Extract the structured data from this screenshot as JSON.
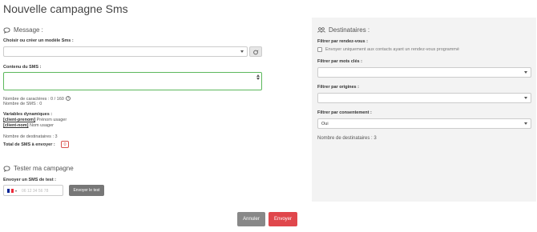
{
  "page": {
    "title": "Nouvelle campagne Sms"
  },
  "message": {
    "heading": "Message :",
    "model_label": "Choisir ou créer un modèle Sms :",
    "model_value": "",
    "content_label": "Contenu du SMS :",
    "content_value": "",
    "char_count": "Nombre de caractères : 0 / 160",
    "sms_count": "Nombre de SMS : 0",
    "vars_label": "Variables dynamiques :",
    "vars": [
      {
        "tag": "[client-prenom]",
        "desc": "Prénom usager"
      },
      {
        "tag": "[client-nom]",
        "desc": "Nom usager"
      }
    ],
    "recipients_count": "Nombre de destinataires : 3",
    "total_label": "Total de SMS à envoyer :",
    "total_value": "0"
  },
  "test": {
    "heading": "Tester ma campagne",
    "send_label": "Envoyer un SMS de test :",
    "phone_placeholder": "06 12 34 56 78",
    "send_button": "Envoyer le test"
  },
  "recipients": {
    "heading": "Destinataires :",
    "filter_appointment_label": "Filtrer par rendez-vous :",
    "appointment_checkbox_label": "Envoyer uniquement aux contacts ayant un rendez-vous programmé",
    "filter_keywords_label": "Filtrer par mots clés :",
    "keywords_value": "",
    "filter_origins_label": "Filtrer par origines :",
    "origins_value": "",
    "filter_consent_label": "Filtrer par consentement :",
    "consent_value": "Oui",
    "recipients_count": "Nombre de destinataires : 3"
  },
  "actions": {
    "cancel": "Annuler",
    "send": "Envoyer"
  },
  "colors": {
    "accent": "#e0474c",
    "valid": "#5cb85c",
    "panel": "#f3f3f3"
  },
  "icons": [
    "comment-icon",
    "users-icon",
    "magic-icon",
    "help-circle-icon",
    "france-flag-icon"
  ]
}
